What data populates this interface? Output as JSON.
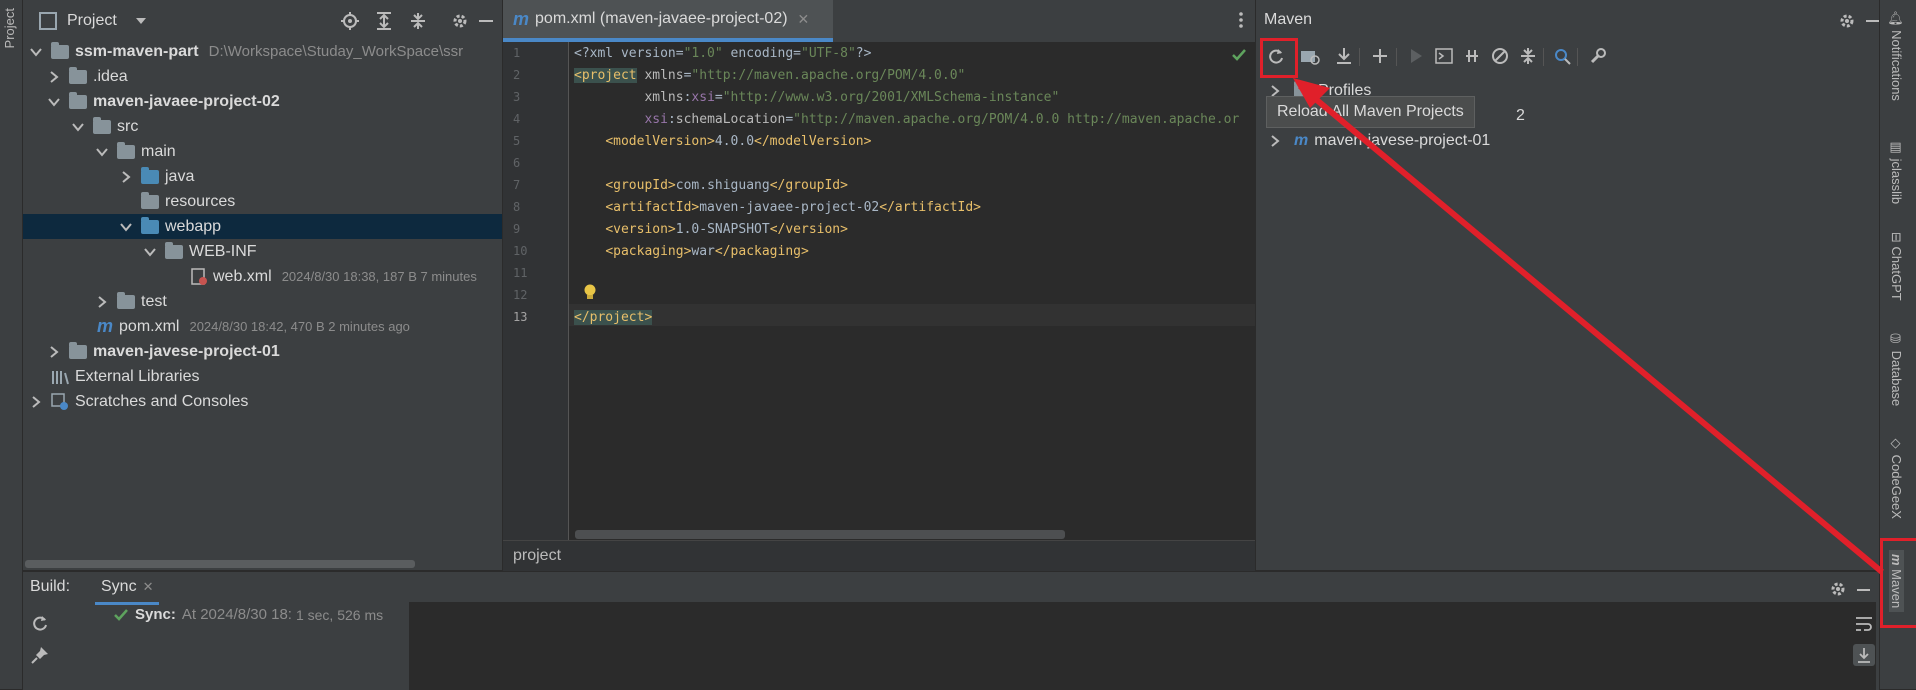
{
  "left_strip": {
    "tab_label": "Project"
  },
  "project": {
    "title": "Project",
    "tree": [
      {
        "label": "ssm-maven-part",
        "meta": "D:\\Workspace\\Studay_WorkSpace\\ssr"
      },
      {
        "label": ".idea"
      },
      {
        "label": "maven-javaee-project-02"
      },
      {
        "label": "src"
      },
      {
        "label": "main"
      },
      {
        "label": "java"
      },
      {
        "label": "resources"
      },
      {
        "label": "webapp"
      },
      {
        "label": "WEB-INF"
      },
      {
        "label": "web.xml",
        "meta": "2024/8/30 18:38, 187 B 7 minutes"
      },
      {
        "label": "test"
      },
      {
        "label": "pom.xml",
        "meta": "2024/8/30 18:42, 470 B 2 minutes ago"
      },
      {
        "label": "maven-javese-project-01"
      },
      {
        "label": "External Libraries"
      },
      {
        "label": "Scratches and Consoles"
      }
    ]
  },
  "editor": {
    "tab_label": "pom.xml (maven-javaee-project-02)",
    "line_numbers": [
      "1",
      "2",
      "3",
      "4",
      "5",
      "6",
      "7",
      "8",
      "9",
      "10",
      "11",
      "12",
      "13"
    ],
    "breadcrumb": "project"
  },
  "maven": {
    "title": "Maven",
    "tooltip": "Reload All Maven Projects",
    "tree": [
      {
        "label": "Profiles"
      },
      {
        "label": "2"
      },
      {
        "label": "maven-javese-project-01"
      }
    ]
  },
  "build": {
    "title": "Build:",
    "tab": "Sync",
    "sync_label": "Sync:",
    "sync_text": "At 2024/8/30 18:",
    "sync_time": "1 sec, 526 ms"
  },
  "right_strip": {
    "tabs": [
      "Notifications",
      "jclasslib",
      "ChatGPT",
      "Database",
      "CodeGeeX",
      "Maven"
    ]
  },
  "colors": {
    "accent": "#4a88c7",
    "highlight": "#e0202a",
    "selection": "#0d293e"
  }
}
